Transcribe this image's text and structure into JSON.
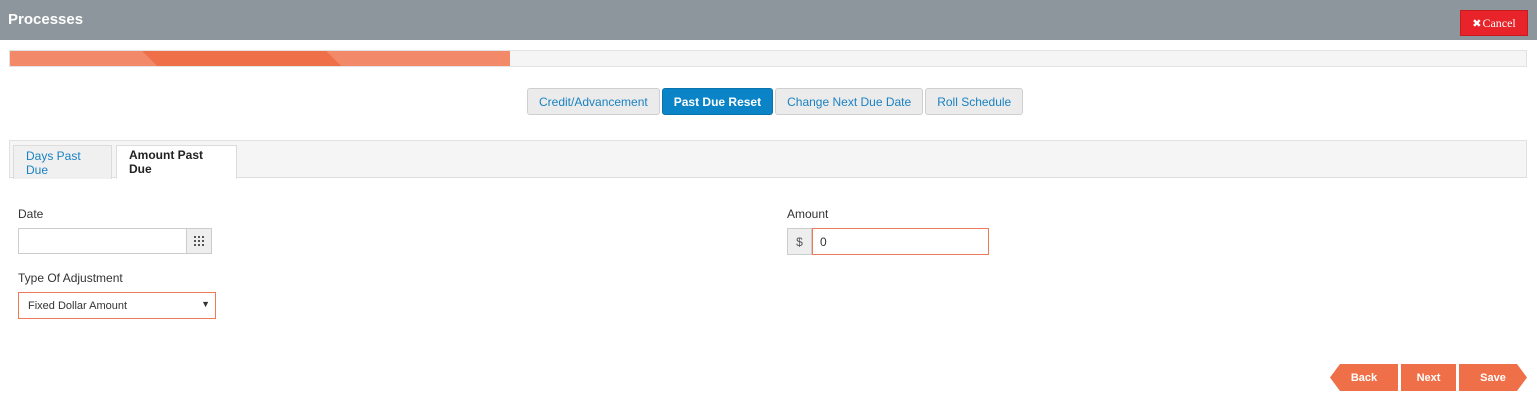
{
  "header": {
    "title": "Processes",
    "cancel_icon": "x-icon",
    "cancel_label": "Cancel"
  },
  "progress": {
    "value_percent": 33
  },
  "process_tabs": [
    {
      "label": "Credit/Advancement",
      "active": false
    },
    {
      "label": "Past Due Reset",
      "active": true
    },
    {
      "label": "Change Next Due Date",
      "active": false
    },
    {
      "label": "Roll Schedule",
      "active": false
    }
  ],
  "sub_tabs": [
    {
      "label": "Days Past Due",
      "active": false
    },
    {
      "label": "Amount Past Due",
      "active": true
    }
  ],
  "form": {
    "date_label": "Date",
    "date_value": "",
    "calendar_icon": "calendar-grid-icon",
    "adjustment_label": "Type Of Adjustment",
    "adjustment_selected": "Fixed Dollar Amount",
    "amount_label": "Amount",
    "currency_symbol": "$",
    "amount_value": "0"
  },
  "footer": {
    "back_label": "Back",
    "next_label": "Next",
    "save_label": "Save"
  },
  "colors": {
    "header": "#8c969c",
    "accent_orange": "#ef6f48",
    "active_tab_blue": "#0a83c7",
    "cancel_red": "#e8242a",
    "link_blue": "#1a82c2"
  }
}
